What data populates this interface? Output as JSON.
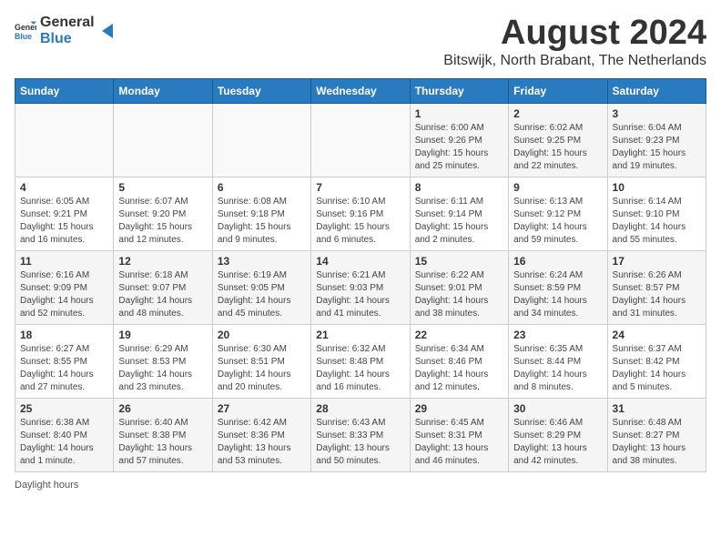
{
  "logo": {
    "general": "General",
    "blue": "Blue"
  },
  "title": "August 2024",
  "subtitle": "Bitswijk, North Brabant, The Netherlands",
  "days_of_week": [
    "Sunday",
    "Monday",
    "Tuesday",
    "Wednesday",
    "Thursday",
    "Friday",
    "Saturday"
  ],
  "footer": "Daylight hours",
  "weeks": [
    [
      {
        "day": "",
        "sunrise": "",
        "sunset": "",
        "daylight": ""
      },
      {
        "day": "",
        "sunrise": "",
        "sunset": "",
        "daylight": ""
      },
      {
        "day": "",
        "sunrise": "",
        "sunset": "",
        "daylight": ""
      },
      {
        "day": "",
        "sunrise": "",
        "sunset": "",
        "daylight": ""
      },
      {
        "day": "1",
        "sunrise": "Sunrise: 6:00 AM",
        "sunset": "Sunset: 9:26 PM",
        "daylight": "Daylight: 15 hours and 25 minutes."
      },
      {
        "day": "2",
        "sunrise": "Sunrise: 6:02 AM",
        "sunset": "Sunset: 9:25 PM",
        "daylight": "Daylight: 15 hours and 22 minutes."
      },
      {
        "day": "3",
        "sunrise": "Sunrise: 6:04 AM",
        "sunset": "Sunset: 9:23 PM",
        "daylight": "Daylight: 15 hours and 19 minutes."
      }
    ],
    [
      {
        "day": "4",
        "sunrise": "Sunrise: 6:05 AM",
        "sunset": "Sunset: 9:21 PM",
        "daylight": "Daylight: 15 hours and 16 minutes."
      },
      {
        "day": "5",
        "sunrise": "Sunrise: 6:07 AM",
        "sunset": "Sunset: 9:20 PM",
        "daylight": "Daylight: 15 hours and 12 minutes."
      },
      {
        "day": "6",
        "sunrise": "Sunrise: 6:08 AM",
        "sunset": "Sunset: 9:18 PM",
        "daylight": "Daylight: 15 hours and 9 minutes."
      },
      {
        "day": "7",
        "sunrise": "Sunrise: 6:10 AM",
        "sunset": "Sunset: 9:16 PM",
        "daylight": "Daylight: 15 hours and 6 minutes."
      },
      {
        "day": "8",
        "sunrise": "Sunrise: 6:11 AM",
        "sunset": "Sunset: 9:14 PM",
        "daylight": "Daylight: 15 hours and 2 minutes."
      },
      {
        "day": "9",
        "sunrise": "Sunrise: 6:13 AM",
        "sunset": "Sunset: 9:12 PM",
        "daylight": "Daylight: 14 hours and 59 minutes."
      },
      {
        "day": "10",
        "sunrise": "Sunrise: 6:14 AM",
        "sunset": "Sunset: 9:10 PM",
        "daylight": "Daylight: 14 hours and 55 minutes."
      }
    ],
    [
      {
        "day": "11",
        "sunrise": "Sunrise: 6:16 AM",
        "sunset": "Sunset: 9:09 PM",
        "daylight": "Daylight: 14 hours and 52 minutes."
      },
      {
        "day": "12",
        "sunrise": "Sunrise: 6:18 AM",
        "sunset": "Sunset: 9:07 PM",
        "daylight": "Daylight: 14 hours and 48 minutes."
      },
      {
        "day": "13",
        "sunrise": "Sunrise: 6:19 AM",
        "sunset": "Sunset: 9:05 PM",
        "daylight": "Daylight: 14 hours and 45 minutes."
      },
      {
        "day": "14",
        "sunrise": "Sunrise: 6:21 AM",
        "sunset": "Sunset: 9:03 PM",
        "daylight": "Daylight: 14 hours and 41 minutes."
      },
      {
        "day": "15",
        "sunrise": "Sunrise: 6:22 AM",
        "sunset": "Sunset: 9:01 PM",
        "daylight": "Daylight: 14 hours and 38 minutes."
      },
      {
        "day": "16",
        "sunrise": "Sunrise: 6:24 AM",
        "sunset": "Sunset: 8:59 PM",
        "daylight": "Daylight: 14 hours and 34 minutes."
      },
      {
        "day": "17",
        "sunrise": "Sunrise: 6:26 AM",
        "sunset": "Sunset: 8:57 PM",
        "daylight": "Daylight: 14 hours and 31 minutes."
      }
    ],
    [
      {
        "day": "18",
        "sunrise": "Sunrise: 6:27 AM",
        "sunset": "Sunset: 8:55 PM",
        "daylight": "Daylight: 14 hours and 27 minutes."
      },
      {
        "day": "19",
        "sunrise": "Sunrise: 6:29 AM",
        "sunset": "Sunset: 8:53 PM",
        "daylight": "Daylight: 14 hours and 23 minutes."
      },
      {
        "day": "20",
        "sunrise": "Sunrise: 6:30 AM",
        "sunset": "Sunset: 8:51 PM",
        "daylight": "Daylight: 14 hours and 20 minutes."
      },
      {
        "day": "21",
        "sunrise": "Sunrise: 6:32 AM",
        "sunset": "Sunset: 8:48 PM",
        "daylight": "Daylight: 14 hours and 16 minutes."
      },
      {
        "day": "22",
        "sunrise": "Sunrise: 6:34 AM",
        "sunset": "Sunset: 8:46 PM",
        "daylight": "Daylight: 14 hours and 12 minutes."
      },
      {
        "day": "23",
        "sunrise": "Sunrise: 6:35 AM",
        "sunset": "Sunset: 8:44 PM",
        "daylight": "Daylight: 14 hours and 8 minutes."
      },
      {
        "day": "24",
        "sunrise": "Sunrise: 6:37 AM",
        "sunset": "Sunset: 8:42 PM",
        "daylight": "Daylight: 14 hours and 5 minutes."
      }
    ],
    [
      {
        "day": "25",
        "sunrise": "Sunrise: 6:38 AM",
        "sunset": "Sunset: 8:40 PM",
        "daylight": "Daylight: 14 hours and 1 minute."
      },
      {
        "day": "26",
        "sunrise": "Sunrise: 6:40 AM",
        "sunset": "Sunset: 8:38 PM",
        "daylight": "Daylight: 13 hours and 57 minutes."
      },
      {
        "day": "27",
        "sunrise": "Sunrise: 6:42 AM",
        "sunset": "Sunset: 8:36 PM",
        "daylight": "Daylight: 13 hours and 53 minutes."
      },
      {
        "day": "28",
        "sunrise": "Sunrise: 6:43 AM",
        "sunset": "Sunset: 8:33 PM",
        "daylight": "Daylight: 13 hours and 50 minutes."
      },
      {
        "day": "29",
        "sunrise": "Sunrise: 6:45 AM",
        "sunset": "Sunset: 8:31 PM",
        "daylight": "Daylight: 13 hours and 46 minutes."
      },
      {
        "day": "30",
        "sunrise": "Sunrise: 6:46 AM",
        "sunset": "Sunset: 8:29 PM",
        "daylight": "Daylight: 13 hours and 42 minutes."
      },
      {
        "day": "31",
        "sunrise": "Sunrise: 6:48 AM",
        "sunset": "Sunset: 8:27 PM",
        "daylight": "Daylight: 13 hours and 38 minutes."
      }
    ]
  ]
}
